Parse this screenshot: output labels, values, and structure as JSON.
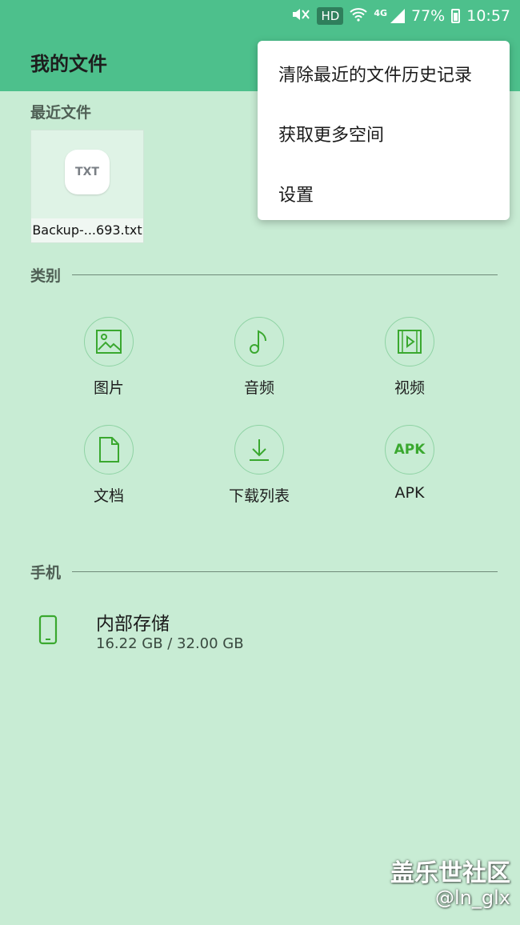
{
  "status_bar": {
    "hd_badge": "HD",
    "network_type": "4G",
    "battery_percent": "77%",
    "time": "10:57",
    "icons": [
      "mute-vibrate-icon",
      "wifi-icon",
      "signal-icon",
      "battery-icon"
    ]
  },
  "app_bar": {
    "title": "我的文件"
  },
  "recent": {
    "title": "最近文件",
    "files": [
      {
        "icon_text": "TXT",
        "name": "Backup-...693.txt"
      }
    ]
  },
  "categories": {
    "title": "类别",
    "items": [
      {
        "label": "图片",
        "icon": "image-icon"
      },
      {
        "label": "音频",
        "icon": "music-note-icon"
      },
      {
        "label": "视频",
        "icon": "video-icon"
      },
      {
        "label": "文档",
        "icon": "document-icon"
      },
      {
        "label": "下载列表",
        "icon": "download-icon"
      },
      {
        "label": "APK",
        "icon": "apk-icon",
        "icon_text": "APK"
      }
    ]
  },
  "phone": {
    "title": "手机",
    "storage": {
      "name": "内部存储",
      "usage": "16.22 GB / 32.00 GB",
      "icon": "phone-icon"
    }
  },
  "menu": {
    "items": [
      "清除最近的文件历史记录",
      "获取更多空间",
      "设置"
    ]
  },
  "watermark": {
    "line1": "盖乐世社区",
    "line2": "@ln_glx"
  },
  "colors": {
    "header": "#4dc08c",
    "background": "#c8ecd4",
    "accent": "#3aa82f"
  }
}
